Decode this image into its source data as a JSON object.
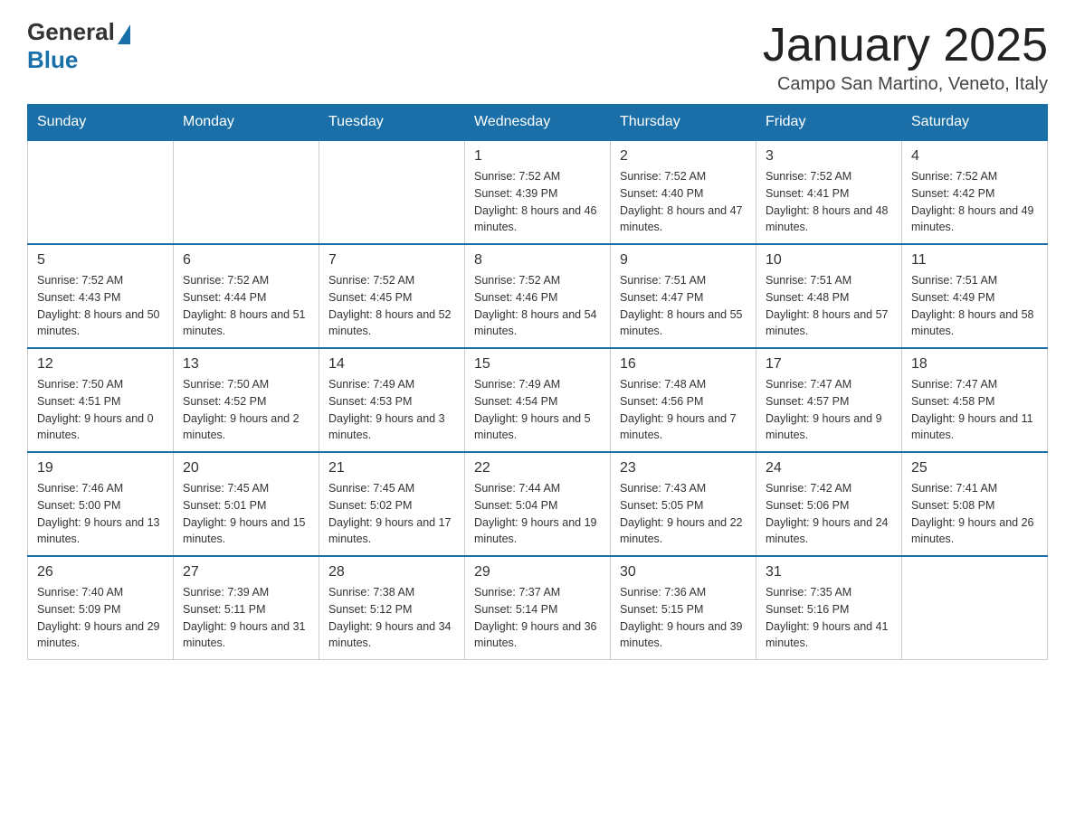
{
  "header": {
    "logo_general": "General",
    "logo_blue": "Blue",
    "month_title": "January 2025",
    "location": "Campo San Martino, Veneto, Italy"
  },
  "days_of_week": [
    "Sunday",
    "Monday",
    "Tuesday",
    "Wednesday",
    "Thursday",
    "Friday",
    "Saturday"
  ],
  "weeks": [
    [
      {
        "day": "",
        "info": ""
      },
      {
        "day": "",
        "info": ""
      },
      {
        "day": "",
        "info": ""
      },
      {
        "day": "1",
        "info": "Sunrise: 7:52 AM\nSunset: 4:39 PM\nDaylight: 8 hours\nand 46 minutes."
      },
      {
        "day": "2",
        "info": "Sunrise: 7:52 AM\nSunset: 4:40 PM\nDaylight: 8 hours\nand 47 minutes."
      },
      {
        "day": "3",
        "info": "Sunrise: 7:52 AM\nSunset: 4:41 PM\nDaylight: 8 hours\nand 48 minutes."
      },
      {
        "day": "4",
        "info": "Sunrise: 7:52 AM\nSunset: 4:42 PM\nDaylight: 8 hours\nand 49 minutes."
      }
    ],
    [
      {
        "day": "5",
        "info": "Sunrise: 7:52 AM\nSunset: 4:43 PM\nDaylight: 8 hours\nand 50 minutes."
      },
      {
        "day": "6",
        "info": "Sunrise: 7:52 AM\nSunset: 4:44 PM\nDaylight: 8 hours\nand 51 minutes."
      },
      {
        "day": "7",
        "info": "Sunrise: 7:52 AM\nSunset: 4:45 PM\nDaylight: 8 hours\nand 52 minutes."
      },
      {
        "day": "8",
        "info": "Sunrise: 7:52 AM\nSunset: 4:46 PM\nDaylight: 8 hours\nand 54 minutes."
      },
      {
        "day": "9",
        "info": "Sunrise: 7:51 AM\nSunset: 4:47 PM\nDaylight: 8 hours\nand 55 minutes."
      },
      {
        "day": "10",
        "info": "Sunrise: 7:51 AM\nSunset: 4:48 PM\nDaylight: 8 hours\nand 57 minutes."
      },
      {
        "day": "11",
        "info": "Sunrise: 7:51 AM\nSunset: 4:49 PM\nDaylight: 8 hours\nand 58 minutes."
      }
    ],
    [
      {
        "day": "12",
        "info": "Sunrise: 7:50 AM\nSunset: 4:51 PM\nDaylight: 9 hours\nand 0 minutes."
      },
      {
        "day": "13",
        "info": "Sunrise: 7:50 AM\nSunset: 4:52 PM\nDaylight: 9 hours\nand 2 minutes."
      },
      {
        "day": "14",
        "info": "Sunrise: 7:49 AM\nSunset: 4:53 PM\nDaylight: 9 hours\nand 3 minutes."
      },
      {
        "day": "15",
        "info": "Sunrise: 7:49 AM\nSunset: 4:54 PM\nDaylight: 9 hours\nand 5 minutes."
      },
      {
        "day": "16",
        "info": "Sunrise: 7:48 AM\nSunset: 4:56 PM\nDaylight: 9 hours\nand 7 minutes."
      },
      {
        "day": "17",
        "info": "Sunrise: 7:47 AM\nSunset: 4:57 PM\nDaylight: 9 hours\nand 9 minutes."
      },
      {
        "day": "18",
        "info": "Sunrise: 7:47 AM\nSunset: 4:58 PM\nDaylight: 9 hours\nand 11 minutes."
      }
    ],
    [
      {
        "day": "19",
        "info": "Sunrise: 7:46 AM\nSunset: 5:00 PM\nDaylight: 9 hours\nand 13 minutes."
      },
      {
        "day": "20",
        "info": "Sunrise: 7:45 AM\nSunset: 5:01 PM\nDaylight: 9 hours\nand 15 minutes."
      },
      {
        "day": "21",
        "info": "Sunrise: 7:45 AM\nSunset: 5:02 PM\nDaylight: 9 hours\nand 17 minutes."
      },
      {
        "day": "22",
        "info": "Sunrise: 7:44 AM\nSunset: 5:04 PM\nDaylight: 9 hours\nand 19 minutes."
      },
      {
        "day": "23",
        "info": "Sunrise: 7:43 AM\nSunset: 5:05 PM\nDaylight: 9 hours\nand 22 minutes."
      },
      {
        "day": "24",
        "info": "Sunrise: 7:42 AM\nSunset: 5:06 PM\nDaylight: 9 hours\nand 24 minutes."
      },
      {
        "day": "25",
        "info": "Sunrise: 7:41 AM\nSunset: 5:08 PM\nDaylight: 9 hours\nand 26 minutes."
      }
    ],
    [
      {
        "day": "26",
        "info": "Sunrise: 7:40 AM\nSunset: 5:09 PM\nDaylight: 9 hours\nand 29 minutes."
      },
      {
        "day": "27",
        "info": "Sunrise: 7:39 AM\nSunset: 5:11 PM\nDaylight: 9 hours\nand 31 minutes."
      },
      {
        "day": "28",
        "info": "Sunrise: 7:38 AM\nSunset: 5:12 PM\nDaylight: 9 hours\nand 34 minutes."
      },
      {
        "day": "29",
        "info": "Sunrise: 7:37 AM\nSunset: 5:14 PM\nDaylight: 9 hours\nand 36 minutes."
      },
      {
        "day": "30",
        "info": "Sunrise: 7:36 AM\nSunset: 5:15 PM\nDaylight: 9 hours\nand 39 minutes."
      },
      {
        "day": "31",
        "info": "Sunrise: 7:35 AM\nSunset: 5:16 PM\nDaylight: 9 hours\nand 41 minutes."
      },
      {
        "day": "",
        "info": ""
      }
    ]
  ]
}
